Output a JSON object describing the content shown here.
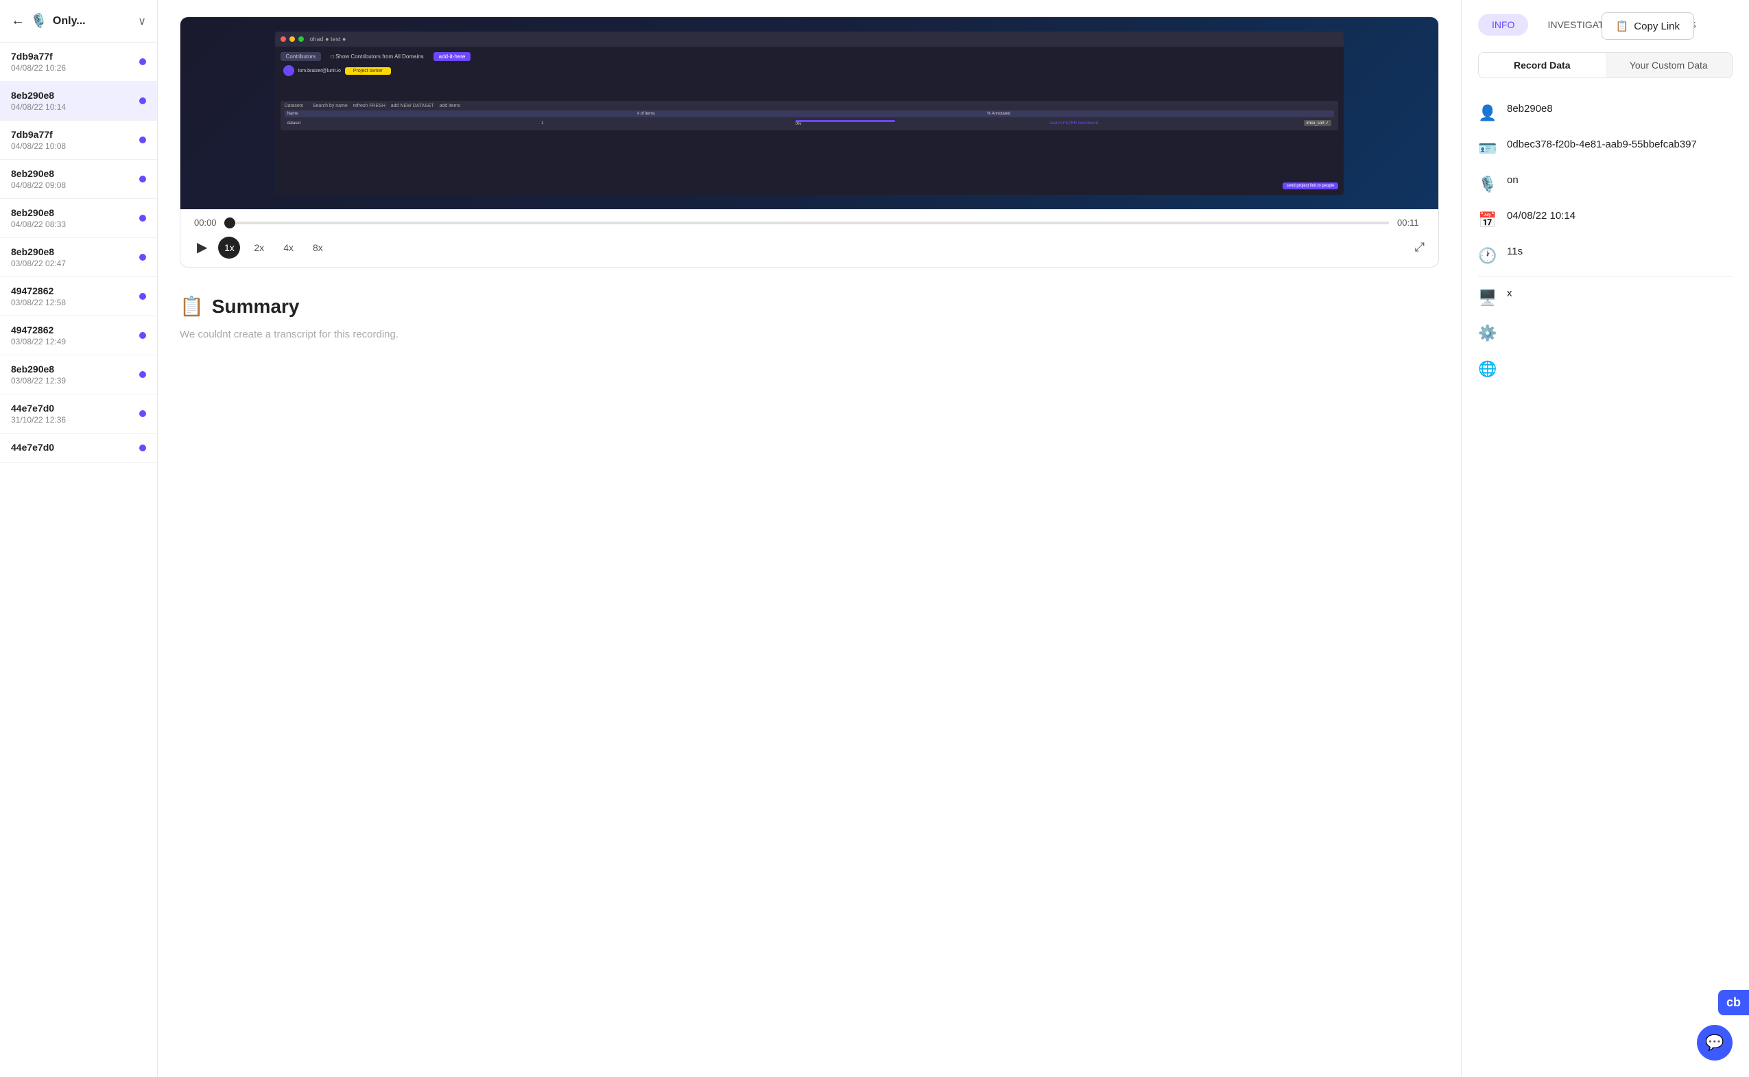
{
  "sidebar": {
    "back_icon": "←",
    "header_icon": "🎙️",
    "title": "Only...",
    "chevron": "∨",
    "items": [
      {
        "id": "7db9a77f",
        "date": "04/08/22 10:26",
        "active": false
      },
      {
        "id": "8eb290e8",
        "date": "04/08/22 10:14",
        "active": true
      },
      {
        "id": "7db9a77f",
        "date": "04/08/22 10:08",
        "active": false
      },
      {
        "id": "8eb290e8",
        "date": "04/08/22 09:08",
        "active": false
      },
      {
        "id": "8eb290e8",
        "date": "04/08/22 08:33",
        "active": false
      },
      {
        "id": "8eb290e8",
        "date": "03/08/22 02:47",
        "active": false
      },
      {
        "id": "49472862",
        "date": "03/08/22 12:58",
        "active": false
      },
      {
        "id": "49472862",
        "date": "03/08/22 12:49",
        "active": false
      },
      {
        "id": "8eb290e8",
        "date": "03/08/22 12:39",
        "active": false
      },
      {
        "id": "44e7e7d0",
        "date": "31/10/22 12:36",
        "active": false
      },
      {
        "id": "44e7e7d0",
        "date": "",
        "active": false
      }
    ]
  },
  "copy_link_btn": "Copy Link",
  "video": {
    "time_start": "00:00",
    "time_end": "00:11",
    "speeds": [
      "1x",
      "2x",
      "4x",
      "8x"
    ],
    "active_speed": "1x"
  },
  "summary": {
    "title": "Summary",
    "text": "We couldnt create a transcript for this recording."
  },
  "right_panel": {
    "info_tabs": [
      "INFO",
      "INVESTIGATE",
      "ANALYTICS"
    ],
    "active_info_tab": "INFO",
    "sub_tabs": [
      "Record Data",
      "Your Custom Data"
    ],
    "active_sub_tab": "Record Data",
    "record_data": {
      "user_icon": "👤",
      "user_id": "8eb290e8",
      "id_icon": "🪪",
      "session_id": "0dbec378-f20b-4e81-aab9-55bbefcab397",
      "mic_icon": "🎙️",
      "mic_status": "on",
      "calendar_icon": "📅",
      "date": "04/08/22 10:14",
      "clock_icon": "🕐",
      "duration": "11s",
      "monitor_icon": "🖥️",
      "monitor_value": "x",
      "cpu_icon": "⚙️",
      "globe_icon": "🌐"
    }
  },
  "chat_btn_icon": "💬",
  "cb_badge": "cb"
}
